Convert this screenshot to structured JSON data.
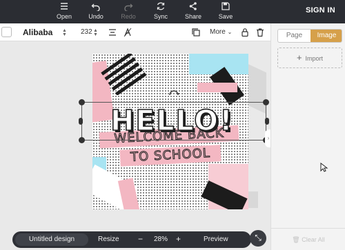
{
  "toolbar": {
    "open": "Open",
    "undo": "Undo",
    "redo": "Redo",
    "sync": "Sync",
    "share": "Share",
    "save": "Save",
    "sign_in": "SIGN IN"
  },
  "format_bar": {
    "font_family": "Alibaba",
    "font_size": "232",
    "more": "More"
  },
  "design": {
    "headline": "HELLO!",
    "banner_line_1": "WELCOME BACK",
    "banner_line_2": "TO SCHOOL"
  },
  "bottom_bar": {
    "design_name": "Untitled design",
    "resize": "Resize",
    "zoom_out": "−",
    "zoom_level": "28%",
    "zoom_in": "+",
    "preview": "Preview"
  },
  "panel": {
    "tabs": [
      {
        "label": "Page",
        "active": false
      },
      {
        "label": "Image",
        "active": true
      }
    ],
    "import": "Import",
    "clear_all": "Clear All"
  },
  "colors": {
    "toolbar_bg": "#2b2d33",
    "accent": "#d6a04a",
    "pink": "#f3b7c2",
    "light_blue": "#a8e4f2"
  },
  "icons": {
    "open": "hamburger-icon",
    "undo": "undo-icon",
    "redo": "redo-icon",
    "sync": "sync-icon",
    "share": "share-icon",
    "save": "save-icon"
  }
}
